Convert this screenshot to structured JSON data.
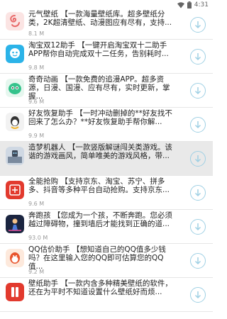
{
  "status_bar": {
    "time": "4:31",
    "wifi_icon": "wifi-icon",
    "battery_icon": "battery-icon"
  },
  "accent_color": "#9fd0e4",
  "apps": [
    {
      "desc": "元气壁纸 【一款海量壁纸库。超多壁纸分类，2K超清壁纸、动漫图应有尽有，支持...",
      "size": "8.1 M",
      "icon": "yuanqi-wallpaper-icon"
    },
    {
      "desc": "淘宝双12助手 【一键开启淘宝双十二助手APP帮你自动完成双十二任务，告别耗时...",
      "size": "9.8 M",
      "icon": "taobao-helper-icon"
    },
    {
      "desc": "奇奇动画 【一款免费的追漫APP。超多资源，日漫、国漫、应有尽有，实时更新，掌握...",
      "size": "9.6 M",
      "icon": "qiqi-anime-icon"
    },
    {
      "desc": "好友恢复助手 【一时冲动删掉的**好友找不回来了怎么办？**好友恢复助手帮你解...",
      "size": "9.9 M",
      "icon": "friend-recovery-icon"
    },
    {
      "desc": "造梦机器人 【一款竖版解谜闯关类游戏。该谐的游戏画风，简单唯美的游戏风格，带...",
      "size": "",
      "icon": "dream-robot-icon"
    },
    {
      "desc": "全能抢购 【支持京东、淘宝、苏宁、拼多多、抖音等多种平台自动抢购。支持京东...",
      "size": "9.6 M",
      "icon": "qiang-icon"
    },
    {
      "desc": "奔跑孩 【您成为一个孩，不断奔跑。您必须越过障碍物，撞到墙后才能找到正确的道...",
      "size": "93.0 M",
      "icon": "runner-game-icon"
    },
    {
      "desc": "QQ估价助手 【想知道自己的QQ值多少钱吗？在这里输入您的QQ即可估算您的QQ值...",
      "size": "9.2 M",
      "icon": "qq-valuation-icon"
    },
    {
      "desc": "壁纸助手 【一款内含多种精美壁纸的软件，还在为平时不知道设置什么壁纸好而烦...",
      "size": "",
      "icon": "wallpaper-helper-icon"
    }
  ]
}
